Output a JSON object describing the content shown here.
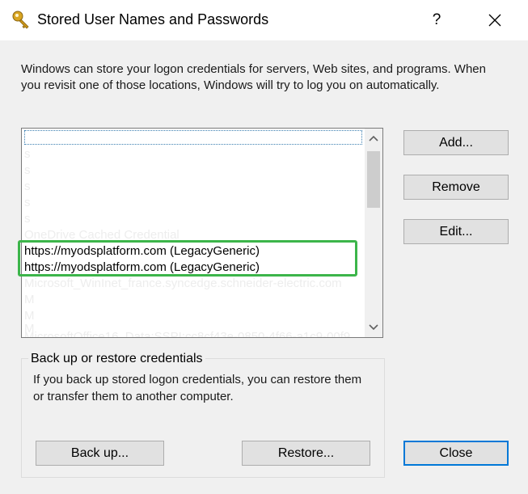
{
  "window": {
    "title": "Stored User Names and Passwords",
    "help_glyph": "?",
    "icons": {
      "app": "key-icon",
      "close": "close-icon"
    }
  },
  "description": "Windows can store your logon credentials for servers, Web sites, and programs. When you revisit one of those locations, Windows will try to log you on automatically.",
  "credentials_list": {
    "items": [
      {
        "text": "",
        "faded": false
      },
      {
        "text": "s",
        "faded": true
      },
      {
        "text": "s",
        "faded": true
      },
      {
        "text": "s",
        "faded": true
      },
      {
        "text": "s",
        "faded": true
      },
      {
        "text": "s",
        "faded": true
      },
      {
        "text": "OneDrive Cached Credential",
        "faded": true
      },
      {
        "text": "https://myodsplatform.com (LegacyGeneric)",
        "faded": false
      },
      {
        "text": "https://myodsplatform.com (LegacyGeneric)",
        "faded": false
      },
      {
        "text": "Microsoft_WinInet_france.syncedge.schneider-electric.com",
        "faded": true
      },
      {
        "text": "M",
        "faded": true
      },
      {
        "text": "M",
        "faded": true
      },
      {
        "text": "M",
        "faded": true
      },
      {
        "text": "MicrosoftOffice16_Data:SSPI:cc8cf43e-0850-4f66-a1c9-00f9",
        "faded": true
      }
    ]
  },
  "buttons": {
    "add": "Add...",
    "remove": "Remove",
    "edit": "Edit...",
    "backup": "Back up...",
    "restore": "Restore...",
    "close": "Close"
  },
  "backup_group": {
    "label": "Back up or restore credentials",
    "description": "If you back up stored logon credentials, you can restore them or transfer them to another computer."
  },
  "colors": {
    "highlight": "#3cb54a",
    "accent": "#0078d7"
  }
}
